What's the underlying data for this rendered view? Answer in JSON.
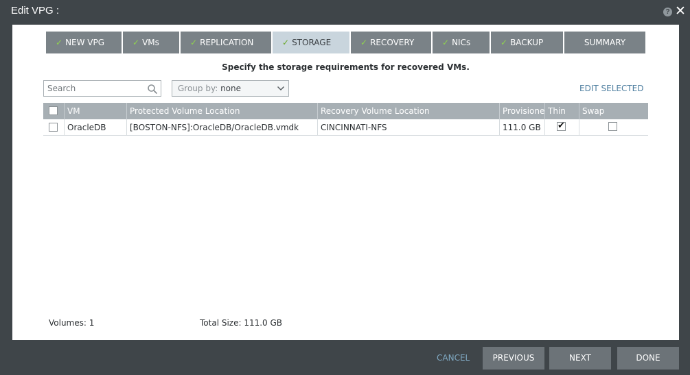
{
  "window": {
    "title": "Edit VPG :",
    "help_icon": "question-mark-icon",
    "close_icon": "close-icon",
    "help_glyph": "?",
    "close_glyph": "✕"
  },
  "tabs": [
    {
      "label": "NEW VPG",
      "completed": true,
      "active": false
    },
    {
      "label": "VMs",
      "completed": true,
      "active": false
    },
    {
      "label": "REPLICATION",
      "completed": true,
      "active": false
    },
    {
      "label": "STORAGE",
      "completed": true,
      "active": true
    },
    {
      "label": "RECOVERY",
      "completed": true,
      "active": false
    },
    {
      "label": "NICs",
      "completed": true,
      "active": false
    },
    {
      "label": "BACKUP",
      "completed": true,
      "active": false
    },
    {
      "label": "SUMMARY",
      "completed": false,
      "active": false
    }
  ],
  "check_glyph": "✓",
  "instructions": "Specify the storage requirements for recovered VMs.",
  "search": {
    "placeholder": "Search",
    "value": ""
  },
  "group_by": {
    "prefix": "Group by:",
    "value": "none"
  },
  "edit_selected_label": "EDIT SELECTED",
  "grid": {
    "columns": [
      "VM",
      "Protected Volume Location",
      "Recovery Volume Location",
      "Provisioned",
      "Thin",
      "Swap"
    ],
    "select_all_checked": false,
    "rows": [
      {
        "selected": false,
        "vm": "OracleDB",
        "protected_location": "[BOSTON-NFS]:OracleDB/OracleDB.vmdk",
        "recovery_location": "CINCINNATI-NFS",
        "provisioned": "111.0 GB",
        "thin": true,
        "swap": false
      }
    ]
  },
  "footer": {
    "volumes": "Volumes: 1",
    "total_size": "Total Size: 111.0 GB"
  },
  "buttons": {
    "cancel": "CANCEL",
    "previous": "PREVIOUS",
    "next": "NEXT",
    "done": "DONE"
  },
  "colors": {
    "check_green": "#8fd14f",
    "active_tab": "#c9d5dd",
    "tab": "#7a8287",
    "link": "#4f7fa0"
  }
}
